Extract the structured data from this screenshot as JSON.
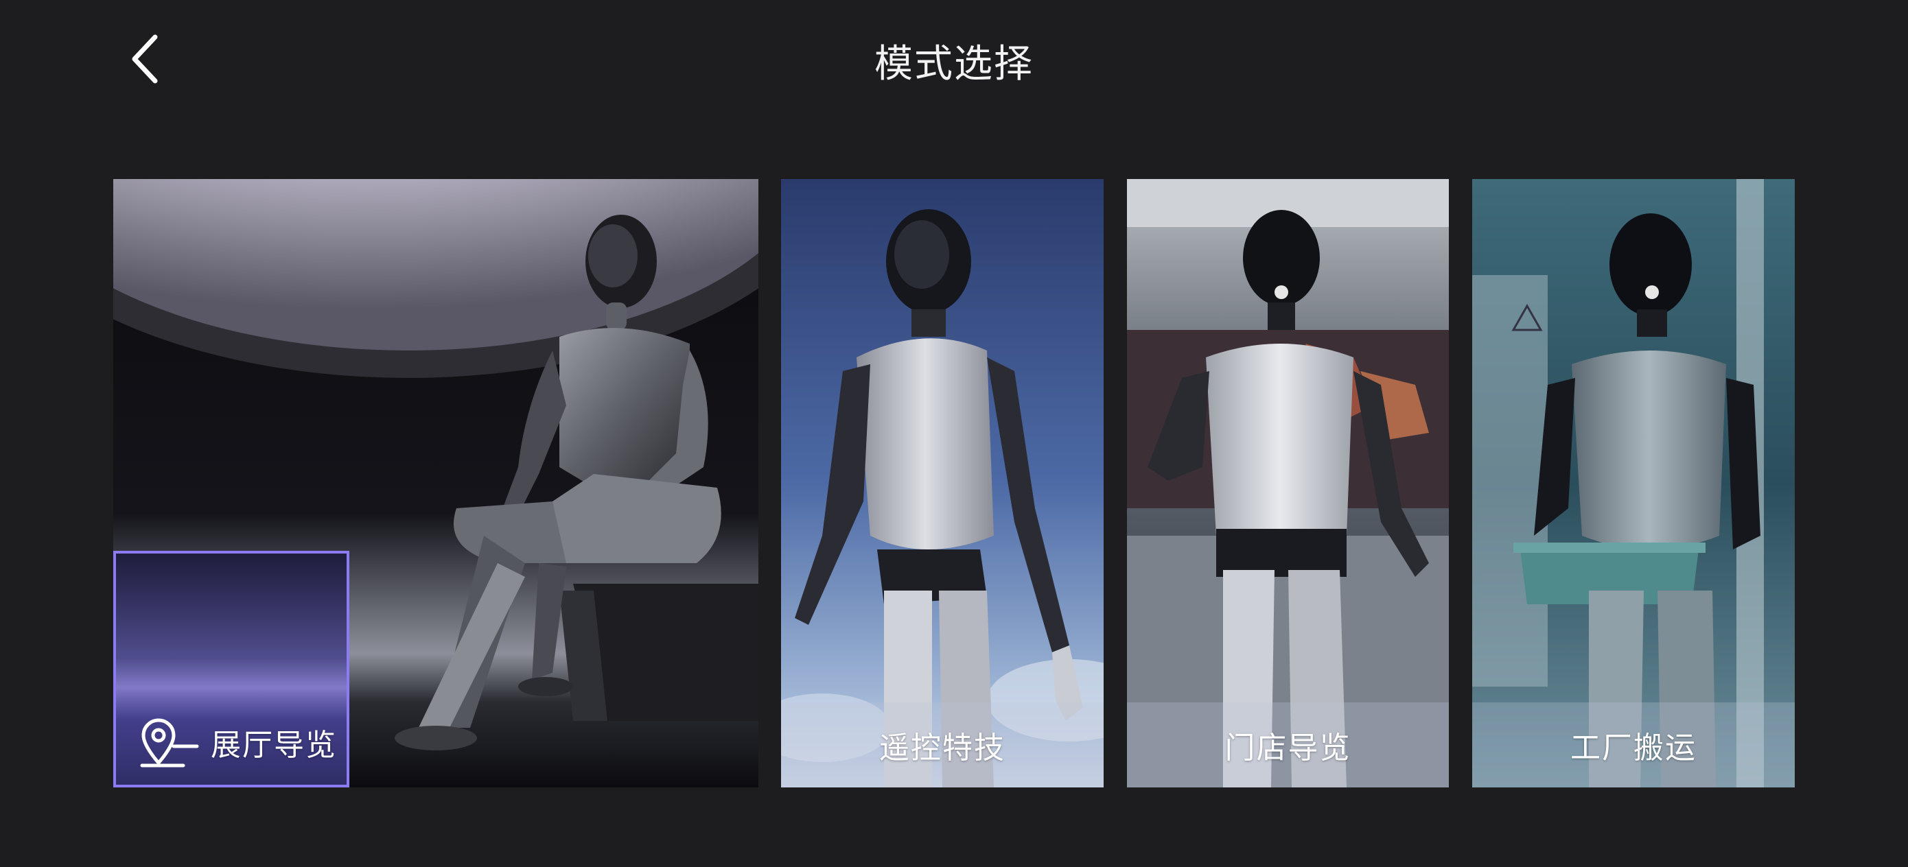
{
  "header": {
    "title": "模式选择",
    "back_icon": "chevron-left-icon"
  },
  "modes": [
    {
      "label": "展厅导览",
      "selected": true,
      "icon": "location-pin-icon"
    },
    {
      "label": "遥控特技",
      "selected": false
    },
    {
      "label": "门店导览",
      "selected": false
    },
    {
      "label": "工厂搬运",
      "selected": false
    }
  ],
  "colors": {
    "background": "#1d1d1f",
    "selected_border": "#8b7cf6",
    "text": "#ffffff"
  }
}
